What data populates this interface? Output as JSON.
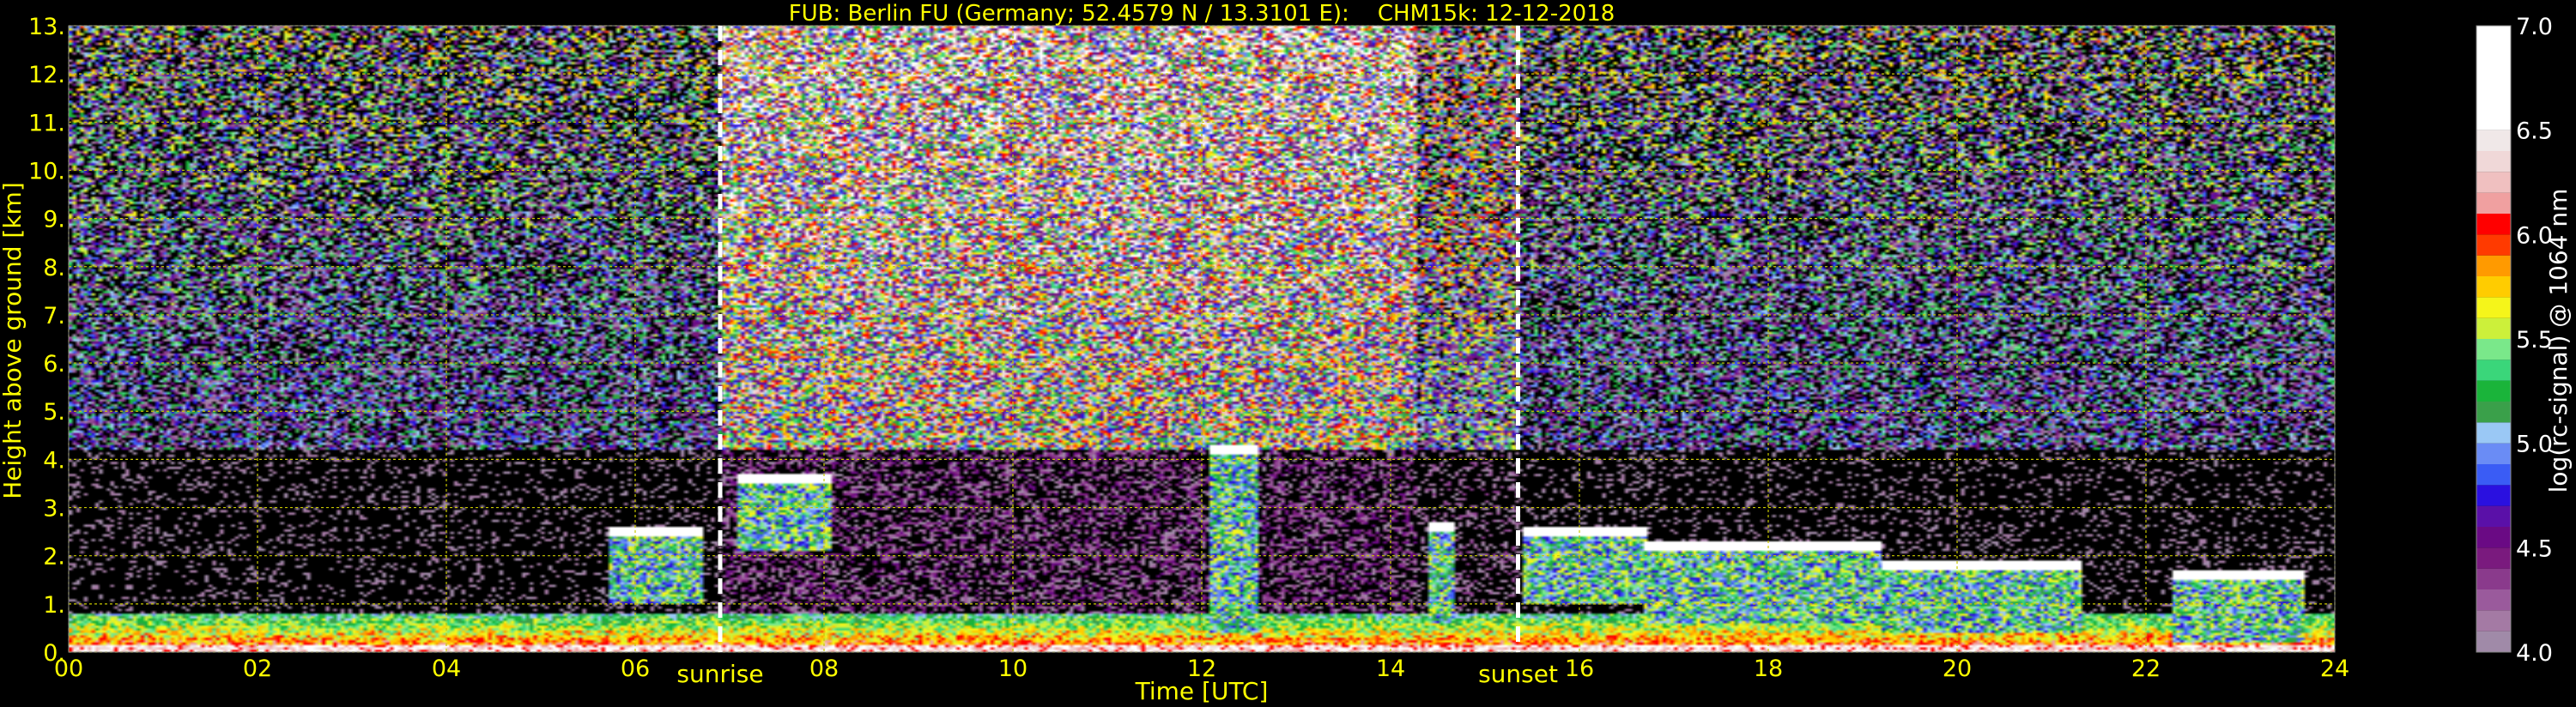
{
  "title": "FUB: Berlin FU (Germany; 52.4579 N / 13.3101 E):    CHM15k: 12-12-2018",
  "colors": {
    "text_yellow": "#ffff00",
    "grid": "#c8c800",
    "marker": "#ffffff",
    "background": "#000000",
    "colorbar_label": "#ffffff"
  },
  "chart_data": {
    "type": "heatmap",
    "title": "FUB: Berlin FU (Germany; 52.4579 N / 13.3101 E):    CHM15k: 12-12-2018",
    "xlabel": "Time [UTC]",
    "ylabel": "Height above ground [km]",
    "xlim": [
      0,
      24
    ],
    "ylim": [
      0,
      13
    ],
    "x_tick_labels": [
      "00",
      "02",
      "04",
      "06",
      "08",
      "10",
      "12",
      "14",
      "16",
      "18",
      "20",
      "22",
      "24"
    ],
    "y_tick_labels": [
      "0.",
      "1.",
      "2.",
      "3.",
      "4.",
      "5.",
      "6.",
      "7.",
      "8.",
      "9.",
      "10.",
      "11.",
      "12.",
      "13."
    ],
    "grid": true,
    "markers": [
      {
        "label": "sunrise",
        "x": 6.9
      },
      {
        "label": "sunset",
        "x": 15.35
      }
    ],
    "colorbar": {
      "label": "log(rc-signal) @ 1064 nm",
      "range": [
        4.0,
        7.0
      ],
      "tick_labels": [
        "4.0",
        "4.5",
        "5.0",
        "5.5",
        "6.0",
        "6.5",
        "7.0"
      ],
      "levels": [
        {
          "from": 4.0,
          "to": 4.1,
          "color": "#a08aa8"
        },
        {
          "from": 4.1,
          "to": 4.2,
          "color": "#a47aa4"
        },
        {
          "from": 4.2,
          "to": 4.3,
          "color": "#9a5a9c"
        },
        {
          "from": 4.3,
          "to": 4.4,
          "color": "#8a3a8c"
        },
        {
          "from": 4.4,
          "to": 4.5,
          "color": "#7a1a7e"
        },
        {
          "from": 4.5,
          "to": 4.6,
          "color": "#6a0a84"
        },
        {
          "from": 4.6,
          "to": 4.7,
          "color": "#5a10a8"
        },
        {
          "from": 4.7,
          "to": 4.8,
          "color": "#2a10e0"
        },
        {
          "from": 4.8,
          "to": 4.9,
          "color": "#3a5cf5"
        },
        {
          "from": 4.9,
          "to": 5.0,
          "color": "#6a8cf5"
        },
        {
          "from": 5.0,
          "to": 5.1,
          "color": "#9ac8f5"
        },
        {
          "from": 5.1,
          "to": 5.2,
          "color": "#3aa04a"
        },
        {
          "from": 5.2,
          "to": 5.3,
          "color": "#1ab43a"
        },
        {
          "from": 5.3,
          "to": 5.4,
          "color": "#3ad67a"
        },
        {
          "from": 5.4,
          "to": 5.5,
          "color": "#7ae88a"
        },
        {
          "from": 5.5,
          "to": 5.6,
          "color": "#ccf03a"
        },
        {
          "from": 5.6,
          "to": 5.7,
          "color": "#f5f51a"
        },
        {
          "from": 5.7,
          "to": 5.8,
          "color": "#ffcc00"
        },
        {
          "from": 5.8,
          "to": 5.9,
          "color": "#ff9a00"
        },
        {
          "from": 5.9,
          "to": 6.0,
          "color": "#ff3a00"
        },
        {
          "from": 6.0,
          "to": 6.1,
          "color": "#ff0000"
        },
        {
          "from": 6.1,
          "to": 6.2,
          "color": "#f0a0a0"
        },
        {
          "from": 6.2,
          "to": 6.3,
          "color": "#f0c0c0"
        },
        {
          "from": 6.3,
          "to": 6.4,
          "color": "#f0d8d8"
        },
        {
          "from": 6.4,
          "to": 6.5,
          "color": "#f0e8e8"
        },
        {
          "from": 6.5,
          "to": 7.0,
          "color": "#ffffff"
        }
      ]
    },
    "features": {
      "cloud_layers": [
        {
          "t0": 5.7,
          "t1": 6.7,
          "h0": 2.2,
          "h1": 2.6
        },
        {
          "t0": 7.1,
          "t1": 8.1,
          "h0": 3.3,
          "h1": 3.7
        },
        {
          "t0": 12.1,
          "t1": 12.6,
          "h0": 1.6,
          "h1": 4.3
        },
        {
          "t0": 14.4,
          "t1": 14.7,
          "h0": 1.8,
          "h1": 2.7
        },
        {
          "t0": 15.4,
          "t1": 16.7,
          "h0": 2.2,
          "h1": 2.6
        },
        {
          "t0": 16.7,
          "t1": 19.2,
          "h0": 1.8,
          "h1": 2.3
        },
        {
          "t0": 19.2,
          "t1": 21.3,
          "h0": 1.6,
          "h1": 1.9
        },
        {
          "t0": 22.3,
          "t1": 23.7,
          "h0": 1.4,
          "h1": 1.7
        }
      ],
      "boundary_layer_top_km": 0.8
    }
  }
}
